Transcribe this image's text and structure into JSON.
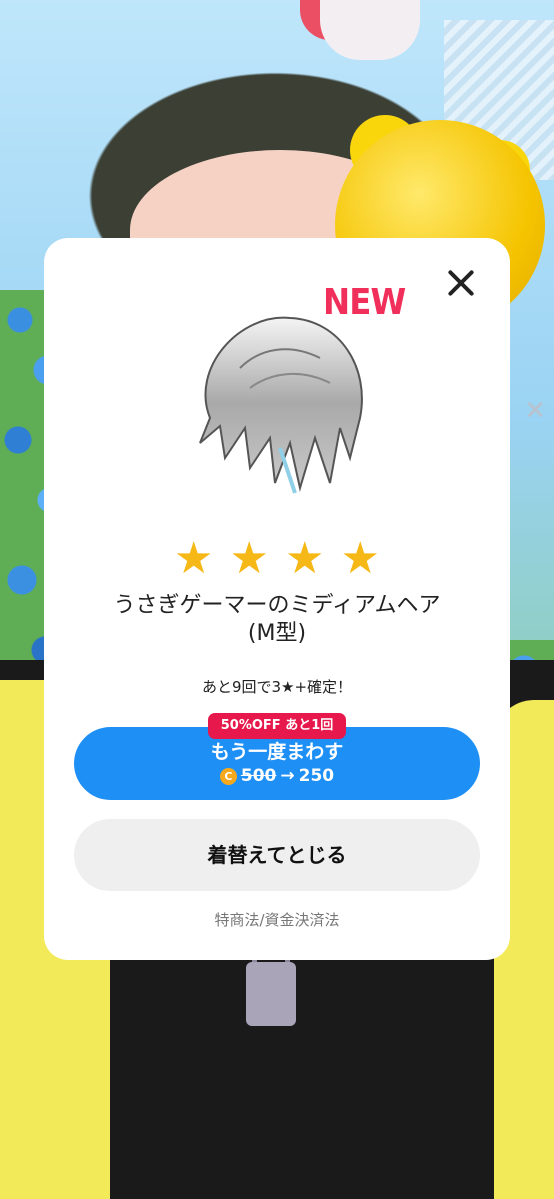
{
  "modal": {
    "new_badge": "NEW",
    "rating_stars": 4,
    "item_name_line1": "うさぎゲーマーのミディアムヘア",
    "item_name_line2": "(M型)",
    "guarantee_text": "あと9回で3★+確定！",
    "discount_badge": "50%OFF あと1回",
    "spin_again_label": "もう一度まわす",
    "coin_icon": "coin-icon",
    "original_price": "500",
    "arrow": "→",
    "discounted_price": "250",
    "equip_close_label": "着替えてとじる",
    "legal_link": "特商法/資金決済法"
  },
  "colors": {
    "primary_blue": "#1e8ff4",
    "discount_red": "#e7184c",
    "new_pink": "#f0305a",
    "star_gold": "#f6b817",
    "coin_orange": "#f6a91c"
  }
}
